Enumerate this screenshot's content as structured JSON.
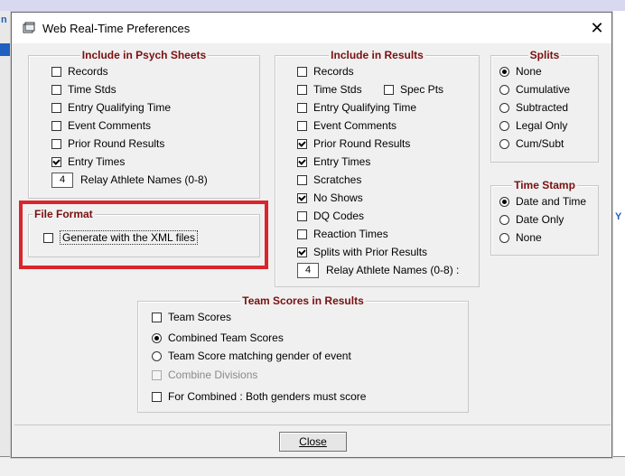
{
  "background": {
    "left_fragment": "n",
    "right_fragment": "Y"
  },
  "dialog": {
    "title": "Web Real-Time Preferences",
    "close_glyph": "✕"
  },
  "psych": {
    "legend": "Include in Psych Sheets",
    "items": [
      {
        "label": "Records",
        "checked": false
      },
      {
        "label": "Time Stds",
        "checked": false
      },
      {
        "label": "Entry Qualifying Time",
        "checked": false
      },
      {
        "label": "Event Comments",
        "checked": false
      },
      {
        "label": "Prior Round Results",
        "checked": false
      },
      {
        "label": "Entry Times",
        "checked": true
      }
    ],
    "relay_value": "4",
    "relay_label": "Relay Athlete Names (0-8)"
  },
  "file_format": {
    "legend": "File Format",
    "xml_label": "Generate with the XML files",
    "xml_checked": false
  },
  "results": {
    "legend": "Include in Results",
    "items": [
      {
        "label": "Records",
        "checked": false
      },
      {
        "label": "Time Stds",
        "checked": false
      },
      {
        "label": "Entry Qualifying Time",
        "checked": false
      },
      {
        "label": "Event Comments",
        "checked": false
      },
      {
        "label": "Prior Round Results",
        "checked": true
      },
      {
        "label": "Entry Times",
        "checked": true
      },
      {
        "label": "Scratches",
        "checked": false
      },
      {
        "label": "No Shows",
        "checked": true
      },
      {
        "label": "DQ Codes",
        "checked": false
      },
      {
        "label": "Reaction Times",
        "checked": false
      },
      {
        "label": "Splits with Prior Results",
        "checked": true
      }
    ],
    "spec_pts_label": "Spec Pts",
    "spec_pts_checked": false,
    "relay_value": "4",
    "relay_label": "Relay Athlete Names (0-8) :"
  },
  "splits": {
    "legend": "Splits",
    "options": [
      "None",
      "Cumulative",
      "Subtracted",
      "Legal Only",
      "Cum/Subt"
    ],
    "selected": "None"
  },
  "timestamp": {
    "legend": "Time Stamp",
    "options": [
      "Date and Time",
      "Date Only",
      "None"
    ],
    "selected": "Date and Time"
  },
  "team_scores": {
    "legend": "Team Scores in Results",
    "team_scores_label": "Team Scores",
    "team_scores_checked": false,
    "combined_label": "Combined Team Scores",
    "matching_label": "Team Score matching gender of event",
    "selected": "Combined Team Scores",
    "combine_divisions_label": "Combine Divisions",
    "both_genders_label": "For Combined : Both genders must score",
    "both_genders_checked": false
  },
  "buttons": {
    "close_label": "Close"
  },
  "colors": {
    "legend": "#7a1010",
    "highlight": "#d9252b"
  }
}
